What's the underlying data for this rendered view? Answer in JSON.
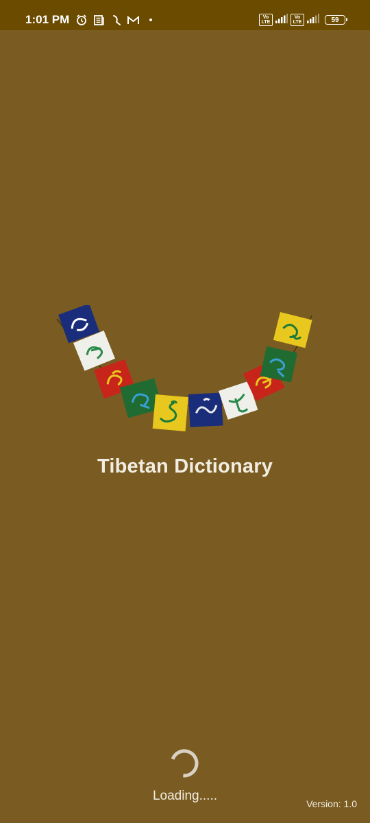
{
  "status_bar": {
    "time": "1:01 PM",
    "left_icons": [
      "alarm-icon",
      "news-icon",
      "moon-icon",
      "gmail-icon",
      "dot-icon"
    ],
    "volte_label_1": "Vo LTE",
    "volte_label_2": "Vo LTE",
    "battery_level": "59"
  },
  "splash": {
    "title": "Tibetan Dictionary",
    "loading_text": "Loading.....",
    "version_text": "Version: 1.0"
  },
  "prayer_flags": {
    "colors": [
      "#1a2d7a",
      "#f0f0ea",
      "#c8251a",
      "#1f6b32",
      "#e8c81e",
      "#1a2d7a",
      "#f0f0ea",
      "#c8251a",
      "#1f6b32",
      "#e8c81e"
    ]
  },
  "colors": {
    "background": "#7a5c22",
    "status_bar": "#6b4b00",
    "text": "#f2ede2"
  }
}
